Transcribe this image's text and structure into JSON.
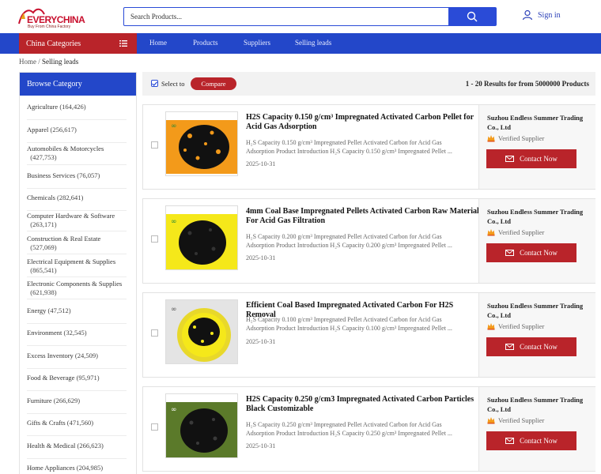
{
  "header": {
    "logo_text": "EVERYCHINA",
    "logo_sub": "Buy From China Factory",
    "search_placeholder": "Search Products...",
    "signin_label": "Sign in"
  },
  "nav": {
    "categories_label": "China Categories",
    "links": [
      "Home",
      "Products",
      "Suppliers",
      "Selling leads"
    ]
  },
  "breadcrumb": {
    "home": "Home",
    "sep": "/",
    "current": "Selling leads"
  },
  "sidebar": {
    "title": "Browse Category",
    "items": [
      {
        "label": "Agriculture",
        "count": "(164,426)"
      },
      {
        "label": "Apparel",
        "count": "(256,617)"
      },
      {
        "label": "Automobiles & Motorcycles",
        "count": "(427,753)"
      },
      {
        "label": "Business Services",
        "count": "(76,057)"
      },
      {
        "label": "Chemicals",
        "count": "(282,641)"
      },
      {
        "label": "Computer Hardware & Software",
        "count": "(263,171)"
      },
      {
        "label": "Construction & Real Estate",
        "count": "(527,069)"
      },
      {
        "label": "Electrical Equipment & Supplies",
        "count": "(865,541)"
      },
      {
        "label": "Electronic Components & Supplies",
        "count": "(621,938)"
      },
      {
        "label": "Energy",
        "count": "(47,512)"
      },
      {
        "label": "Environment",
        "count": "(32,545)"
      },
      {
        "label": "Excess Inventory",
        "count": "(24,509)"
      },
      {
        "label": "Food & Beverage",
        "count": "(95,971)"
      },
      {
        "label": "Furniture",
        "count": "(266,629)"
      },
      {
        "label": "Gifts & Crafts",
        "count": "(471,560)"
      },
      {
        "label": "Health & Medical",
        "count": "(266,623)"
      },
      {
        "label": "Home Appliances",
        "count": "(204,985)"
      }
    ]
  },
  "toolbar": {
    "select_to": "Select to",
    "compare_label": "Compare",
    "results_text": "1 - 20 Results for from 5000000 Products"
  },
  "listings": [
    {
      "title": "H2S Capacity 0.150 g/cm³ Impregnated Activated Carbon Pellet for Acid Gas Adsorption",
      "desc": "H₂S Capacity 0.150 g/cm³ Impregnated Pellet Activated Carbon for Acid Gas Adsorption Product Introduction H₂S Capacity 0.150 g/cm³ Impregnated Pellet ...",
      "date": "2025-10-31",
      "company": "Suzhou Endless Summer Trading Co., Ltd",
      "verified": "Verified Supplier",
      "contact": "Contact Now",
      "bg_color": "#f39a1a"
    },
    {
      "title": "4mm Coal Base Impregnated Pellets Activated Carbon Raw Material For Acid Gas Filtration",
      "desc": "H₂S Capacity 0.200 g/cm³ Impregnated Pellet Activated Carbon for Acid Gas Adsorption Product Introduction H₂S Capacity 0.200 g/cm³ Impregnated Pellet ...",
      "date": "2025-10-31",
      "company": "Suzhou Endless Summer Trading Co., Ltd",
      "verified": "Verified Supplier",
      "contact": "Contact Now",
      "bg_color": "#f5e81a"
    },
    {
      "title": "Efficient Coal Based Impregnated Activated Carbon For H2S Removal",
      "desc": "H₂S Capacity 0.100 g/cm³ Impregnated Pellet Activated Carbon for Acid Gas Adsorption Product Introduction H₂S Capacity 0.100 g/cm³ Impregnated Pellet ...",
      "date": "2025-10-31",
      "company": "Suzhou Endless Summer Trading Co., Ltd",
      "verified": "Verified Supplier",
      "contact": "Contact Now",
      "bg_color": "#e4e4e4"
    },
    {
      "title": "H2S Capacity 0.250 g/cm3 Impregnated Activated Carbon Particles Black Customizable",
      "desc": "H₂S Capacity 0.250 g/cm³ Impregnated Pellet Activated Carbon for Acid Gas Adsorption Product Introduction H₂S Capacity 0.250 g/cm³ Impregnated Pellet ...",
      "date": "2025-10-31",
      "company": "Suzhou Endless Summer Trading Co., Ltd",
      "verified": "Verified Supplier",
      "contact": "Contact Now",
      "bg_color": "#5b7a2a"
    }
  ],
  "colors": {
    "primary_blue": "#2347c9",
    "accent_red": "#b9242a"
  }
}
